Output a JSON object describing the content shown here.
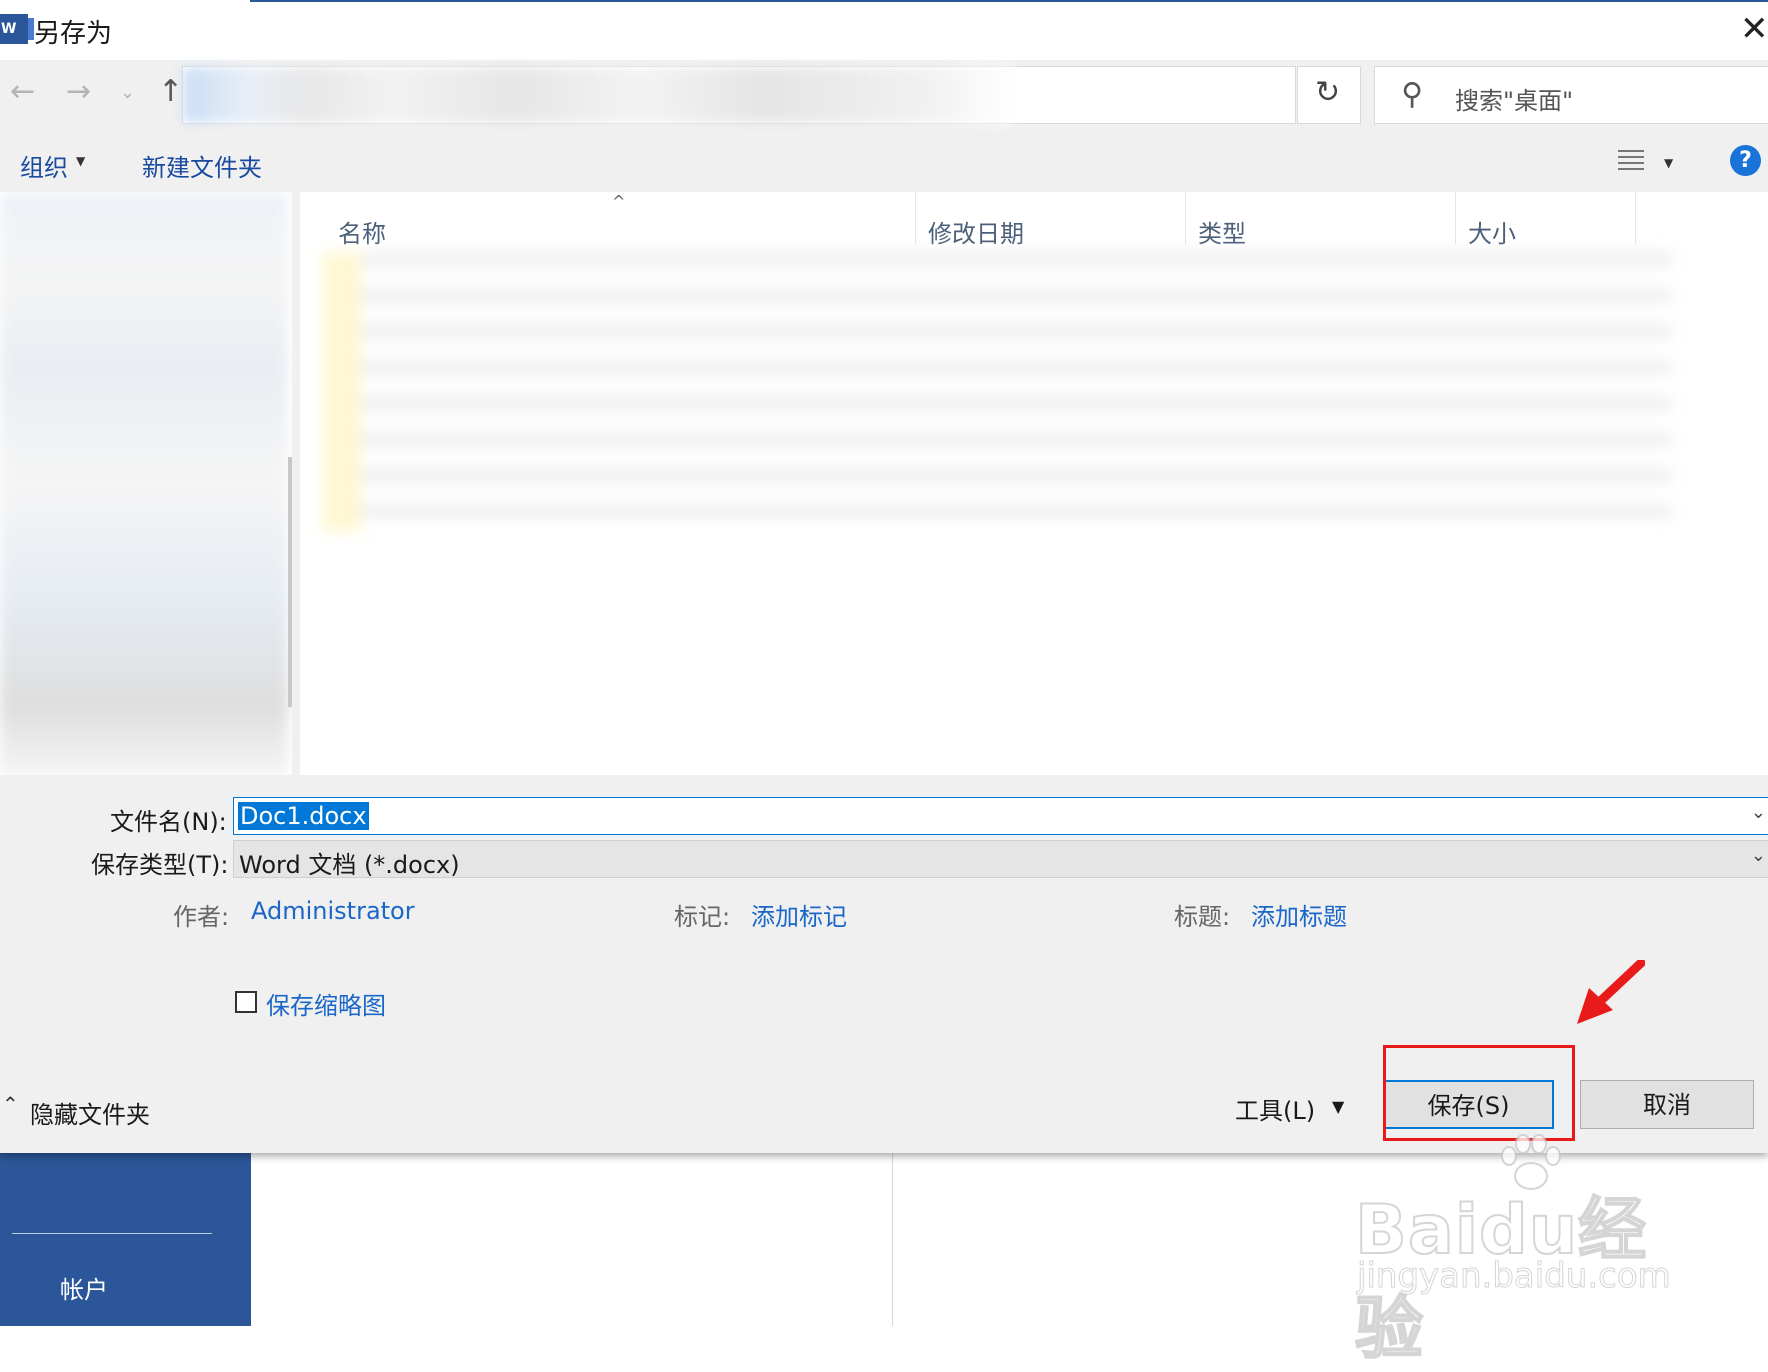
{
  "window": {
    "title": "另存为",
    "app_icon": "word-icon"
  },
  "address": {
    "search_placeholder": "搜索\"桌面\""
  },
  "toolbar": {
    "organize": "组织",
    "new_folder": "新建文件夹"
  },
  "columns": [
    "名称",
    "修改日期",
    "类型",
    "大小"
  ],
  "form": {
    "filename_label": "文件名(N):",
    "filename_value": "Doc1.docx",
    "filetype_label": "保存类型(T):",
    "filetype_value": "Word 文档 (*.docx)",
    "author_label": "作者:",
    "author_value": "Administrator",
    "tags_label": "标记:",
    "tags_value": "添加标记",
    "title_label": "标题:",
    "title_value": "添加标题",
    "thumbnail_label": "保存缩略图",
    "thumbnail_checked": false
  },
  "footer": {
    "hide_folders": "隐藏文件夹",
    "tools": "工具(L)",
    "save": "保存(S)",
    "cancel": "取消"
  },
  "backstage": {
    "account": "帐户"
  },
  "watermark": {
    "brand": "Baidu经验",
    "url": "jingyan.baidu.com"
  },
  "colors": {
    "accent": "#0078d7",
    "word_blue": "#2b579a",
    "annotation_red": "#e81a1a",
    "link_blue": "#1a67c9"
  }
}
